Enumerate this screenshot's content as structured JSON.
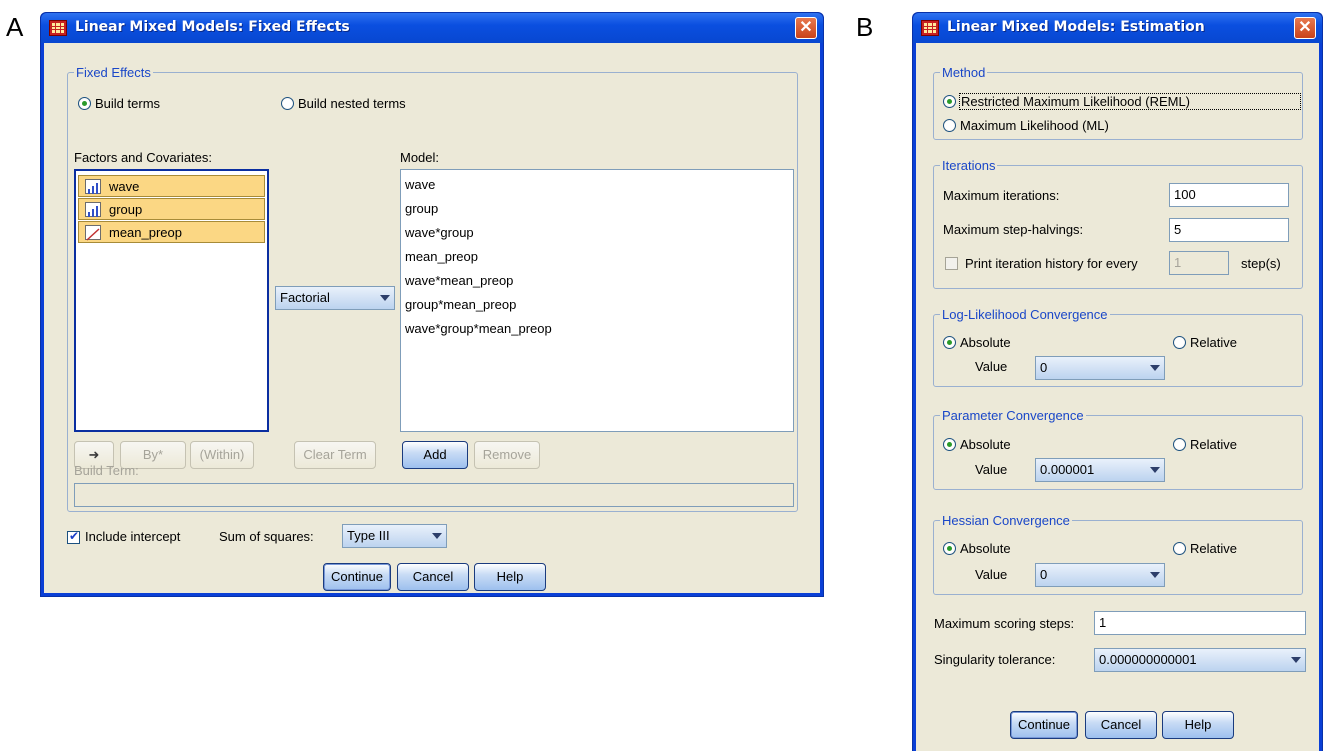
{
  "panel_a_letter": "A",
  "panel_b_letter": "B",
  "fixed": {
    "title": "Linear Mixed Models: Fixed Effects",
    "close": "✕",
    "group_legend": "Fixed Effects",
    "radio_build_terms": "Build terms",
    "radio_build_nested": "Build nested terms",
    "factors_label": "Factors and Covariates:",
    "factors": [
      "wave",
      "group",
      "mean_preop"
    ],
    "model_label": "Model:",
    "model_terms": [
      "wave",
      "group",
      "wave*group",
      "mean_preop",
      "wave*mean_preop",
      "group*mean_preop",
      "wave*group*mean_preop"
    ],
    "factorial_combo": "Factorial",
    "btn_arrow": "➜",
    "btn_by": "By*",
    "btn_within": "(Within)",
    "btn_clear_term": "Clear Term",
    "btn_add": "Add",
    "btn_remove": "Remove",
    "build_term_label": "Build Term:",
    "build_term_value": "",
    "include_intercept": "Include intercept",
    "sum_of_squares_label": "Sum of squares:",
    "sum_of_squares_value": "Type III",
    "btn_continue": "Continue",
    "btn_cancel": "Cancel",
    "btn_help": "Help"
  },
  "estimation": {
    "title": "Linear Mixed Models: Estimation",
    "close": "✕",
    "method_legend": "Method",
    "reml": "Restricted Maximum Likelihood (REML)",
    "ml": "Maximum Likelihood (ML)",
    "iterations_legend": "Iterations",
    "max_iterations_label": "Maximum iterations:",
    "max_iterations_value": "100",
    "max_step_halvings_label": "Maximum step-halvings:",
    "max_step_halvings_value": "5",
    "print_history_label": "Print iteration history for every",
    "print_history_value": "1",
    "steps_label": "step(s)",
    "loglik_legend": "Log-Likelihood Convergence",
    "loglik_absolute": "Absolute",
    "loglik_relative": "Relative",
    "loglik_value_label": "Value",
    "loglik_value": "0",
    "param_legend": "Parameter Convergence",
    "param_absolute": "Absolute",
    "param_relative": "Relative",
    "param_value_label": "Value",
    "param_value": "0.000001",
    "hessian_legend": "Hessian Convergence",
    "hessian_absolute": "Absolute",
    "hessian_relative": "Relative",
    "hessian_value_label": "Value",
    "hessian_value": "0",
    "max_scoring_label": "Maximum scoring steps:",
    "max_scoring_value": "1",
    "singularity_label": "Singularity tolerance:",
    "singularity_value": "0.000000000001",
    "btn_continue": "Continue",
    "btn_cancel": "Cancel",
    "btn_help": "Help"
  }
}
